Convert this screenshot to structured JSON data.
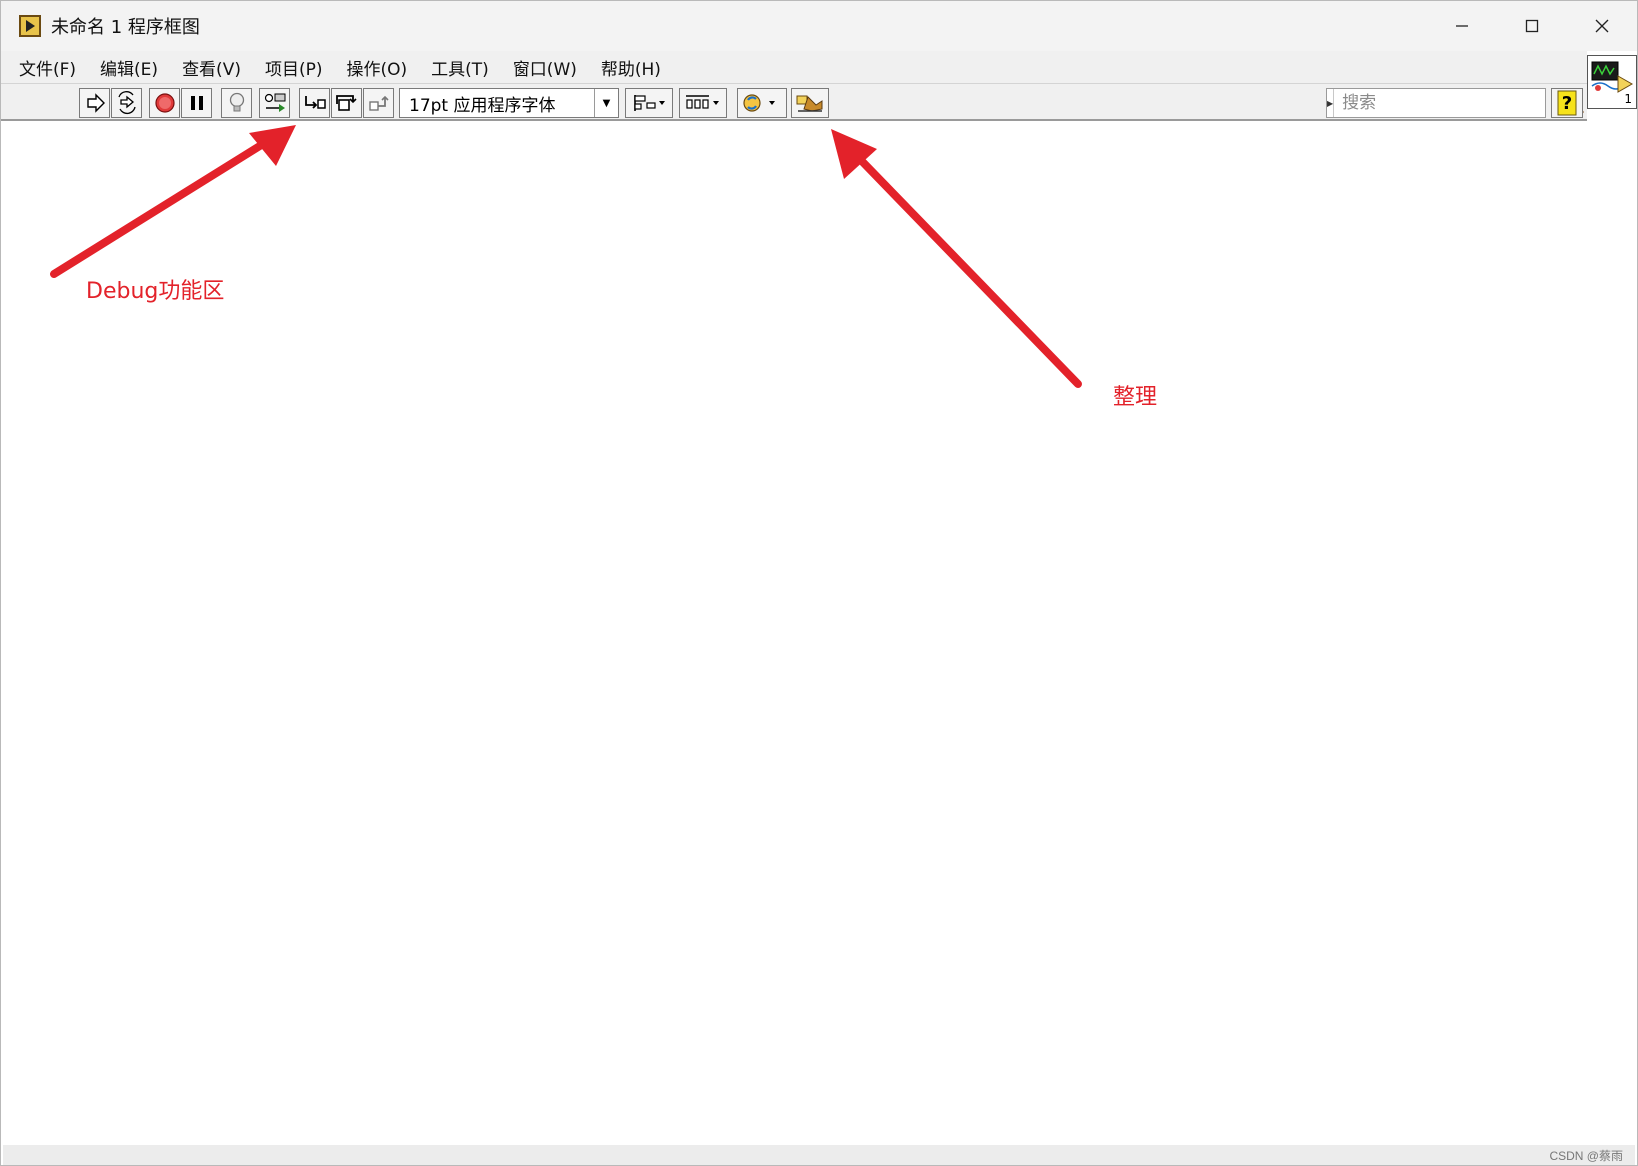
{
  "window": {
    "title": "未命名 1 程序框图",
    "minimize_glyph": "—",
    "maximize_glyph": "☐",
    "close_glyph": "✕"
  },
  "menu": {
    "items": [
      {
        "label": "文件(F)"
      },
      {
        "label": "编辑(E)"
      },
      {
        "label": "查看(V)"
      },
      {
        "label": "项目(P)"
      },
      {
        "label": "操作(O)"
      },
      {
        "label": "工具(T)"
      },
      {
        "label": "窗口(W)"
      },
      {
        "label": "帮助(H)"
      }
    ]
  },
  "toolbar": {
    "font_select": "17pt 应用程序字体",
    "search_placeholder": "搜索",
    "vi_icon_number": "1",
    "icons": {
      "run": "run-arrow-icon",
      "run_continuously": "run-continuously-icon",
      "abort": "abort-stop-icon",
      "pause": "pause-icon",
      "highlight": "highlight-execution-bulb-icon",
      "retain_wire": "retain-wire-values-icon",
      "step_into": "step-into-icon",
      "step_over": "step-over-icon",
      "step_out": "step-out-icon",
      "align": "align-objects-icon",
      "distribute": "distribute-objects-icon",
      "reorder": "reorder-icon",
      "cleanup": "clean-up-diagram-icon",
      "help": "context-help-icon"
    },
    "colors": {
      "abort_red": "#e03a3a",
      "help_yellow": "#f6e21b"
    }
  },
  "annotations": {
    "debug_label": "Debug功能区",
    "cleanup_label": "整理",
    "arrow_color": "#e3222a"
  },
  "footer": {
    "watermark": "CSDN @蔡雨"
  }
}
